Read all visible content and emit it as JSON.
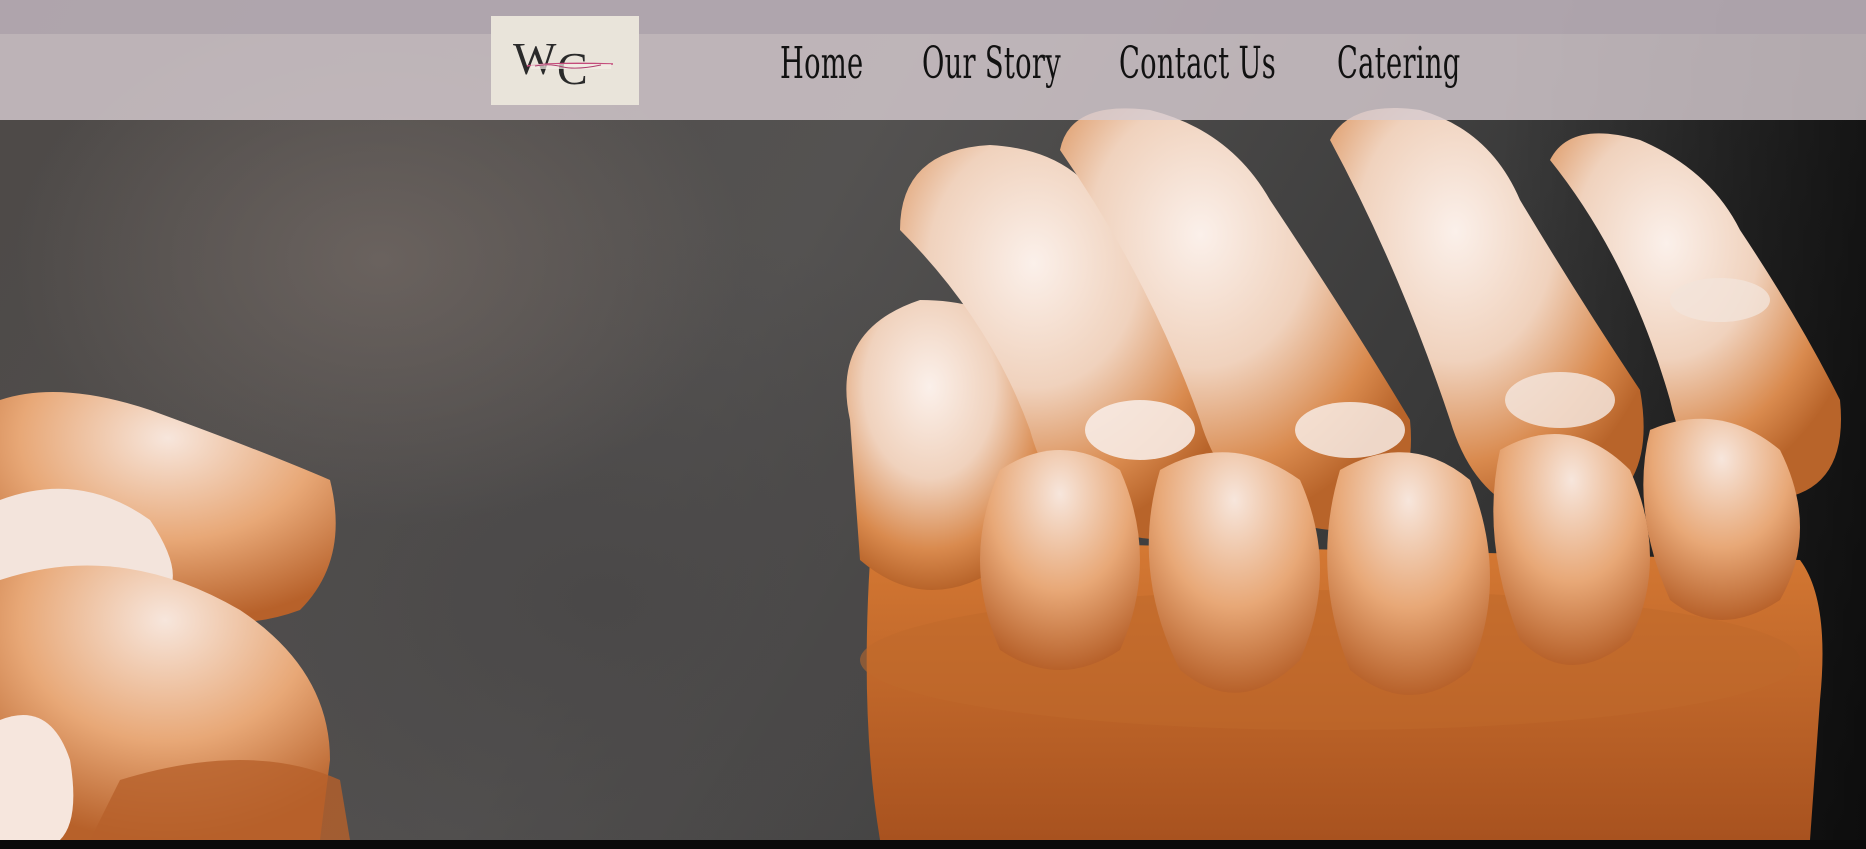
{
  "header": {
    "logo_text": "WC",
    "nav": [
      {
        "label": "Home"
      },
      {
        "label": "Our Story"
      },
      {
        "label": "Contact Us"
      },
      {
        "label": "Catering"
      }
    ]
  },
  "hero": {
    "media": "meringue-tart-video"
  },
  "colors": {
    "top_band": "#b4aab2",
    "nav_bar": "#d6cad0",
    "logo_bg": "#e9e4da",
    "nav_text": "#111111",
    "crust": "#c8702a",
    "meringue": "#f2d8c8"
  }
}
